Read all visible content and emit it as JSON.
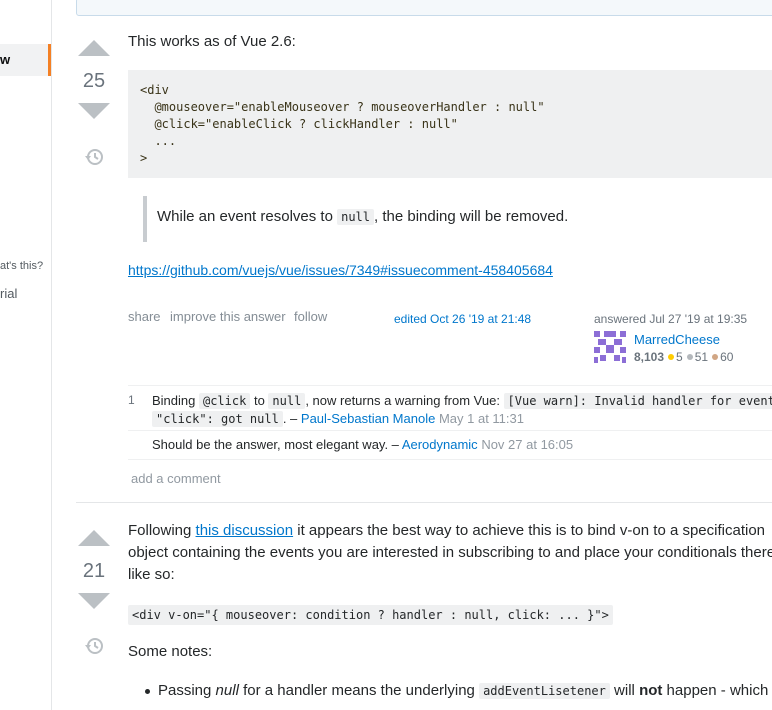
{
  "sidebar": {
    "active_item": "w",
    "text_1": "at's this?",
    "text_2": "rial"
  },
  "answer1": {
    "score": "25",
    "intro": "This works as of Vue 2.6:",
    "code_lines": [
      "<div",
      "  @mouseover=\"enableMouseover ? mouseoverHandler : null\"",
      "  @click=\"enableClick ? clickHandler : null\"",
      "  ...",
      ">"
    ],
    "quote": {
      "before": "While an event resolves to ",
      "code": "null",
      "after": ", the binding will be removed."
    },
    "link": "https://github.com/vuejs/vue/issues/7349#issuecomment-458405684",
    "menu": [
      "share",
      "improve this answer",
      "follow"
    ],
    "edited": "edited Oct 26 '19 at 21:48",
    "answered": "answered Jul 27 '19 at 19:35",
    "user": {
      "name": "MarredCheese",
      "rep": "8,103",
      "gold": "5",
      "silver": "51",
      "bronze": "60"
    },
    "comments": [
      {
        "score": "1",
        "t1": "Binding ",
        "c1": "@click",
        "t2": " to ",
        "c2": "null",
        "t3": ", now returns a warning from Vue: ",
        "c3": "[Vue warn]: Invalid handler for event",
        "c4": "\"click\": got null",
        "t4": ". – ",
        "user": "Paul-Sebastian Manole",
        "date": "May 1 at 11:31"
      },
      {
        "score": "",
        "text": "Should be the answer, most elegant way. – ",
        "user": "Aerodynamic",
        "date": "Nov 27 at 16:05"
      }
    ],
    "add_comment": "add a comment"
  },
  "answer2": {
    "score": "21",
    "p1_before": "Following ",
    "p1_link": "this discussion",
    "p1_after": " it appears the best way to achieve this is to bind v-on to a specification",
    "p2": "object containing the events you are interested in subscribing to and place your conditionals there",
    "p3": "like so:",
    "code": "<div v-on=\"{ mouseover: condition ? handler : null, click: ... }\">",
    "notes_heading": "Some notes:",
    "note1": {
      "t1": "Passing ",
      "em": "null",
      "t2": " for a handler means the underlying ",
      "code": "addEventLisetener",
      "t3": " will ",
      "strong": "not",
      "t4": " happen - which"
    }
  },
  "colors": {
    "accent": "#f48024",
    "link": "#0077cc",
    "gold": "#ffcc01",
    "silver": "#b4b8bc",
    "bronze": "#d1a684"
  }
}
